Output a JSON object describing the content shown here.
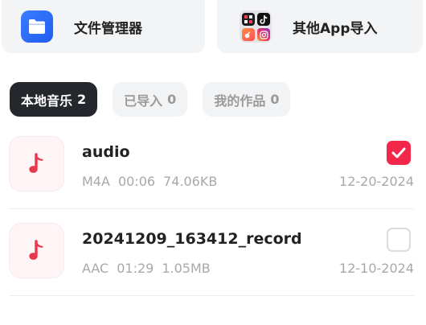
{
  "import_cards": [
    {
      "label": "文件管理器",
      "icon": "folder-icon"
    },
    {
      "label": "其他App导入",
      "icon": "apps-grid-icon"
    }
  ],
  "tabs": [
    {
      "label": "本地音乐",
      "count": "2",
      "active": true
    },
    {
      "label": "已导入",
      "count": "0",
      "active": false
    },
    {
      "label": "我的作品",
      "count": "0",
      "active": false
    }
  ],
  "files": [
    {
      "name": "audio",
      "format": "M4A",
      "duration": "00:06",
      "size": "74.06KB",
      "date": "12-20-2024",
      "selected": true
    },
    {
      "name": "20241209_163412_record",
      "format": "AAC",
      "duration": "01:29",
      "size": "1.05MB",
      "date": "12-10-2024",
      "selected": false
    }
  ],
  "colors": {
    "accent": "#f2274a",
    "music_note": "#e8374f",
    "tab_active_bg": "#24272c",
    "folder_blue": "#2a6cf5"
  }
}
